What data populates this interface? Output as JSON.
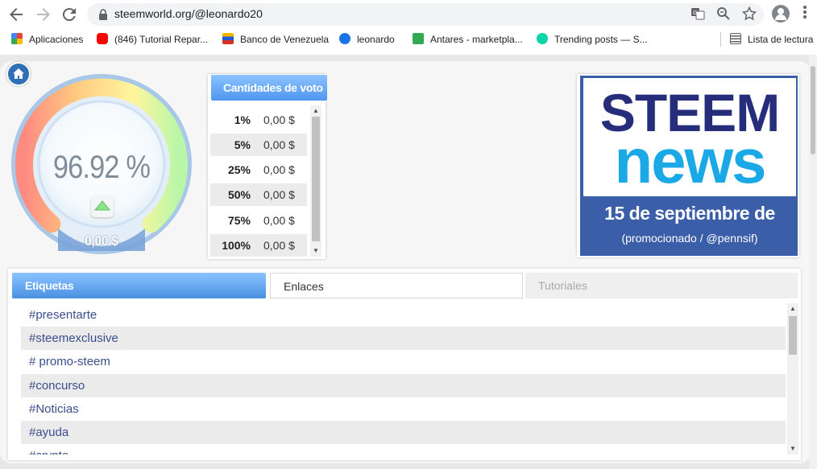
{
  "browser": {
    "url": "steemworld.org/@leonardo20",
    "bookmarks": [
      {
        "label": "Aplicaciones",
        "icon": "apps-grid-icon",
        "color": "#4285f4"
      },
      {
        "label": "(846) Tutorial Repar...",
        "icon": "youtube-icon",
        "color": "#ff0000"
      },
      {
        "label": "Banco de Venezuela",
        "icon": "banco-venezuela-icon",
        "color": "#f4b400"
      },
      {
        "label": "leonardo",
        "icon": "leonardo-icon",
        "color": "#1a73e8"
      },
      {
        "label": "Antares - marketpla...",
        "icon": "antares-icon",
        "color": "#34a853"
      },
      {
        "label": "Trending posts — S...",
        "icon": "steemit-icon",
        "color": "#06d6a9"
      }
    ],
    "reading_list": "Lista de lectura"
  },
  "gauge": {
    "percent_label": "96.92 %",
    "percent_value": 96.92,
    "value_label": "0,00 $"
  },
  "vote_amounts": {
    "header": "Cantidades de voto",
    "rows": [
      {
        "pct": "1%",
        "value": "0,00 $"
      },
      {
        "pct": "5%",
        "value": "0,00 $"
      },
      {
        "pct": "25%",
        "value": "0,00 $"
      },
      {
        "pct": "50%",
        "value": "0,00 $"
      },
      {
        "pct": "75%",
        "value": "0,00 $"
      },
      {
        "pct": "100%",
        "value": "0,00 $"
      }
    ]
  },
  "news_banner": {
    "line1": "STEEM",
    "line2": "news",
    "date": "15 de septiembre de",
    "promo": "(promocionado / @pennsif)",
    "colors": {
      "steem": "#262d7b",
      "news": "#1aa9e6",
      "band": "#3b5ea8"
    }
  },
  "tabs": {
    "items": [
      {
        "label": "Etiquetas",
        "state": "active"
      },
      {
        "label": "Enlaces",
        "state": "normal"
      },
      {
        "label": "Tutoriales",
        "state": "disabled"
      }
    ],
    "tags": [
      "#presentarte",
      "#steemexclusive",
      "# promo-steem",
      "#concurso",
      "#Noticias",
      "#ayuda",
      "#crypto"
    ]
  }
}
